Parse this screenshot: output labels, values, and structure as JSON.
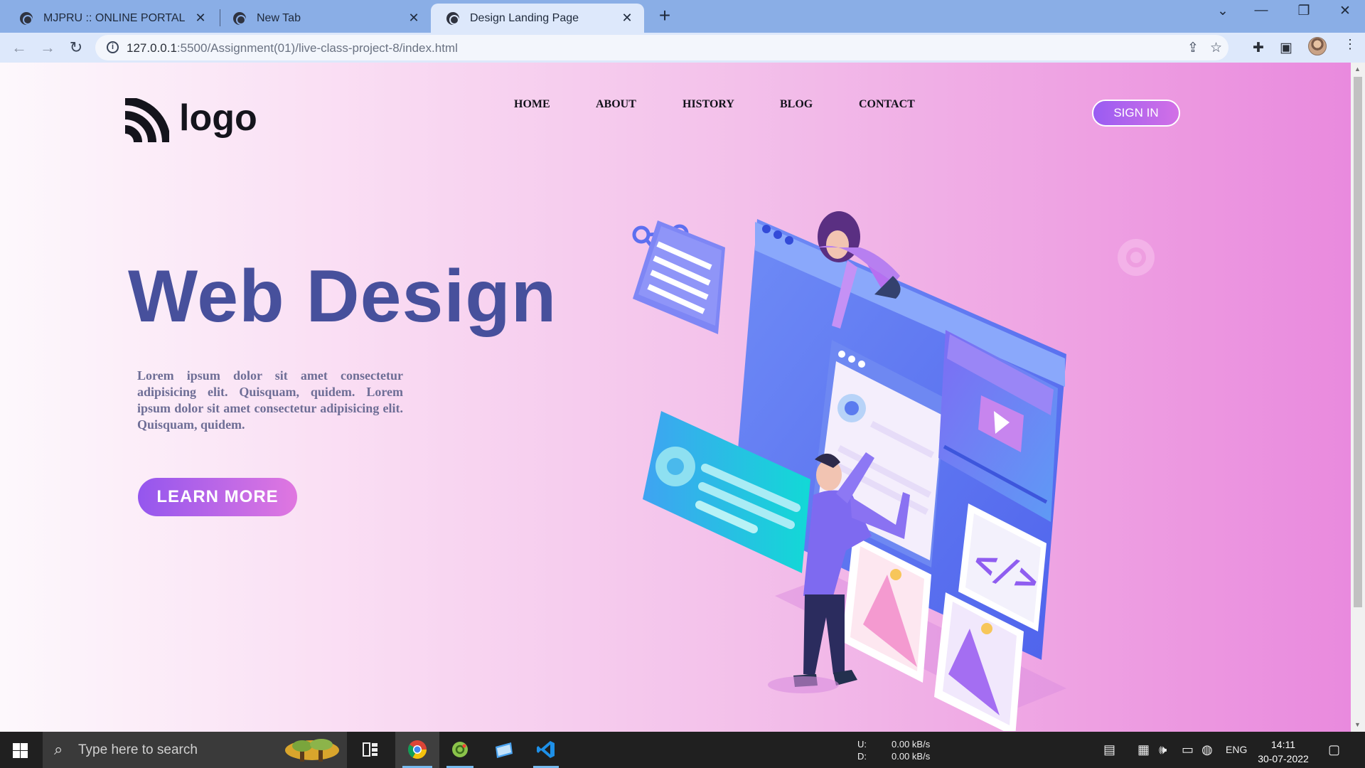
{
  "browser": {
    "tabs": [
      {
        "title": "MJPRU :: ONLINE PORTAL",
        "active": false
      },
      {
        "title": "New Tab",
        "active": false
      },
      {
        "title": "Design Landing Page",
        "active": true
      }
    ],
    "url_host": "127.0.0.1",
    "url_path": ":5500/Assignment(01)/live-class-project-8/index.html"
  },
  "page": {
    "logo_text": "logo",
    "nav": [
      "HOME",
      "ABOUT",
      "HISTORY",
      "BLOG",
      "CONTACT"
    ],
    "signin_label": "SIGN IN",
    "hero_title": "Web Design",
    "hero_text": "Lorem ipsum dolor sit amet consectetur adipisicing elit. Quisquam, quidem. Lorem ipsum dolor sit amet consectetur adipisicing elit. Quisquam, quidem.",
    "cta_label": "LEARN MORE",
    "code_glyph": "</>"
  },
  "taskbar": {
    "search_placeholder": "Type here to search",
    "upload_label": "U:",
    "download_label": "D:",
    "upload_rate": "0.00 kB/s",
    "download_rate": "0.00 kB/s",
    "language": "ENG",
    "time": "14:11",
    "date": "30-07-2022"
  },
  "colors": {
    "title": "#47509c",
    "accent_gradient_start": "#9456ee",
    "accent_gradient_end": "#e077e0",
    "tabstrip": "#8aaee6"
  }
}
